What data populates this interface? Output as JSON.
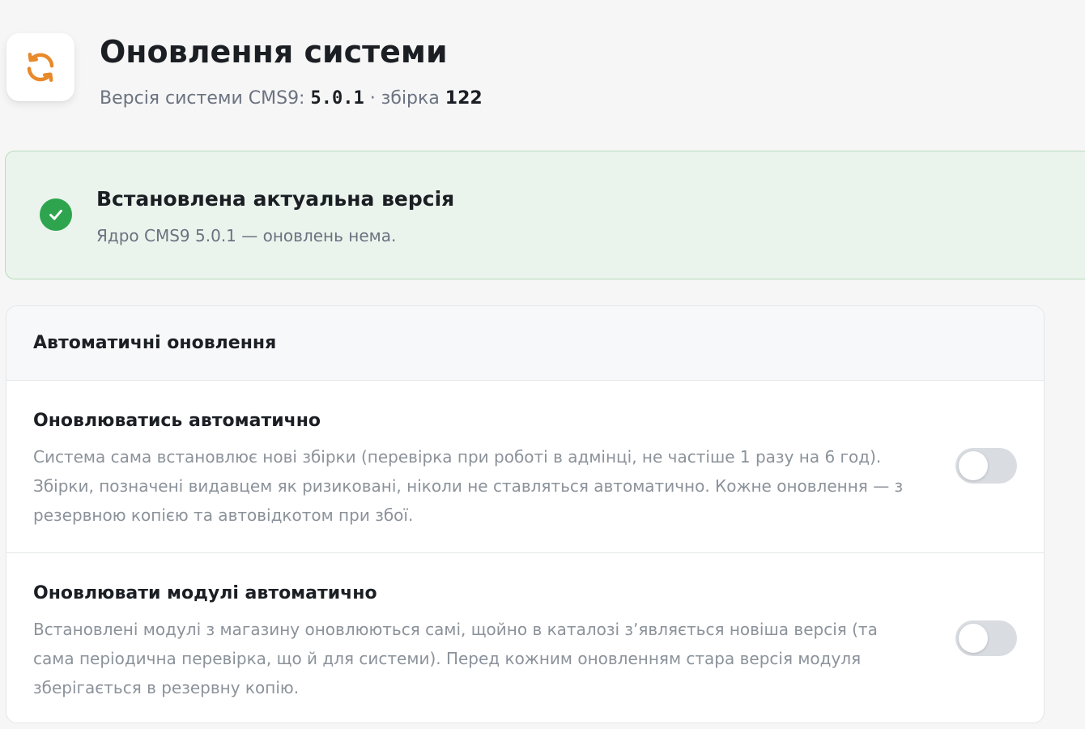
{
  "header": {
    "icon": "refresh-icon",
    "title": "Оновлення системи",
    "version_prefix": "Версія системи CMS9: ",
    "version_number": "5.0.1",
    "build_separator": " · збірка ",
    "build_number": "122"
  },
  "status": {
    "icon": "check-circle-icon",
    "title": "Встановлена актуальна версія",
    "description": "Ядро CMS9 5.0.1 — оновлень нема."
  },
  "auto_updates": {
    "title": "Автоматичні оновлення",
    "settings": [
      {
        "title": "Оновлюватись автоматично",
        "description": "Система сама встановлює нові збірки (перевірка при роботі в адмінці, не частіше 1 разу на 6 год). Збірки, позначені видавцем як ризиковані, ніколи не ставляться автоматично. Кожне оновлення — з резервною копією та автовідкотом при збої.",
        "enabled": false
      },
      {
        "title": "Оновлювати модулі автоматично",
        "description": "Встановлені модулі з магазину оновлюються самі, щойно в каталозі зʼявляється новіша версія (та сама періодична перевірка, що й для системи). Перед кожним оновленням стара версія модуля зберігається в резервну копію.",
        "enabled": false
      }
    ]
  },
  "colors": {
    "accent_orange": "#e8892b",
    "success_green": "#2ea44f",
    "banner_bg": "#ebf4ec",
    "toggle_off": "#d9dde2"
  }
}
